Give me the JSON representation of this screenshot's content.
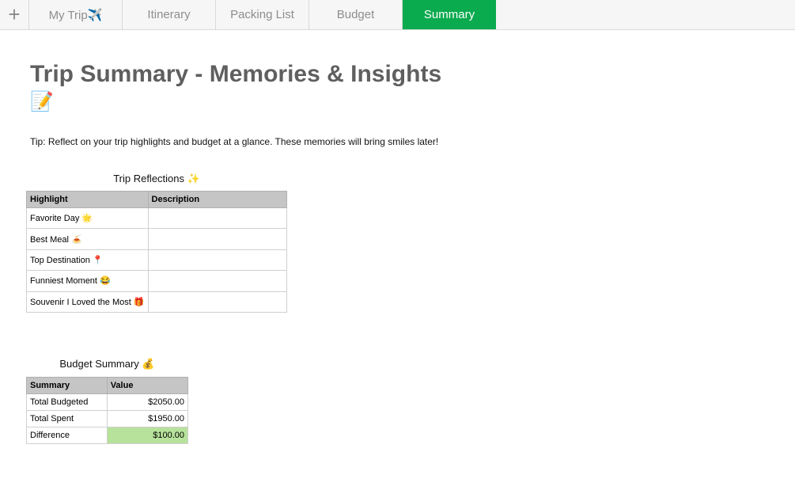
{
  "tabs": [
    {
      "label": "My Trip✈️",
      "active": false
    },
    {
      "label": "Itinerary",
      "active": false
    },
    {
      "label": "Packing List",
      "active": false
    },
    {
      "label": "Budget",
      "active": false
    },
    {
      "label": "Summary",
      "active": true
    }
  ],
  "add_tab_symbol": "+",
  "page": {
    "title": "Trip Summary - Memories & Insights",
    "title_emoji": "📝",
    "tip": "Tip: Reflect on your trip highlights and budget at a glance. These memories will bring smiles later!"
  },
  "reflections": {
    "caption": "Trip Reflections ✨",
    "headers": [
      "Highlight",
      "Description"
    ],
    "rows": [
      {
        "highlight": "Favorite Day 🌟",
        "description": ""
      },
      {
        "highlight": "Best Meal 🍝",
        "description": ""
      },
      {
        "highlight": "Top Destination 📍",
        "description": ""
      },
      {
        "highlight": "Funniest Moment 😂",
        "description": ""
      },
      {
        "highlight": "Souvenir I Loved the Most 🎁",
        "description": ""
      }
    ]
  },
  "budget_summary": {
    "caption": "Budget Summary 💰",
    "headers": [
      "Summary",
      "Value"
    ],
    "rows": [
      {
        "label": "Total Budgeted",
        "value": "$2050.00"
      },
      {
        "label": "Total Spent",
        "value": "$1950.00"
      },
      {
        "label": "Difference",
        "value": "$100.00"
      }
    ]
  },
  "colors": {
    "active_tab": "#0aaa4e",
    "header_fill": "#c5c5c5",
    "positive_fill": "#b7e29b",
    "title_text": "#5f5f5f"
  }
}
